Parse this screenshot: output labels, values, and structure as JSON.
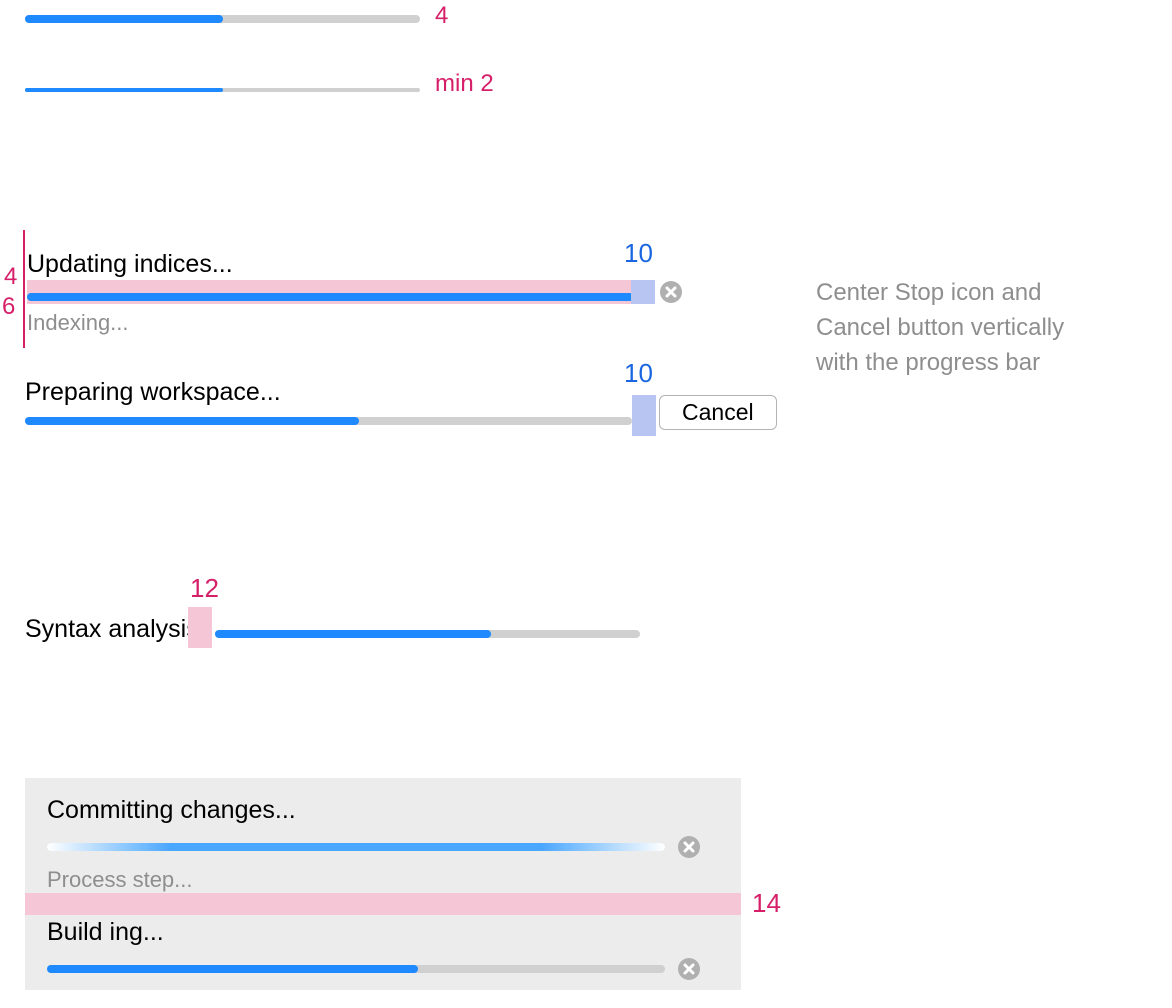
{
  "spec_notes": {
    "bar_spec_label_1": "4",
    "bar_spec_label_2": "min 2",
    "gap_top_label": "4",
    "gap_bottom_label": "6",
    "gap_stop_label_1": "10",
    "gap_stop_label_2": "10",
    "gap_label_to_bar": "12",
    "gap_between_items": "14",
    "side_comment_l1": "Center Stop icon and",
    "side_comment_l2": "Cancel button vertically",
    "side_comment_l3": "with the progress bar"
  },
  "examples": {
    "with_stop_icon": {
      "process_name": "Updating indices...",
      "progress_pct": 100,
      "step_comment": "Indexing..."
    },
    "with_cancel_button": {
      "process_name": "Preparing workspace...",
      "progress_pct": 55,
      "cancel_label": "Cancel"
    },
    "label_on_left": {
      "process_name": "Syntax analysis:",
      "progress_pct": 65
    },
    "stacked": {
      "item1": {
        "process_name": "Committing changes...",
        "step_comment": "Process step..."
      },
      "item2": {
        "process_name": "Build ing...",
        "progress_pct": 60
      }
    }
  }
}
